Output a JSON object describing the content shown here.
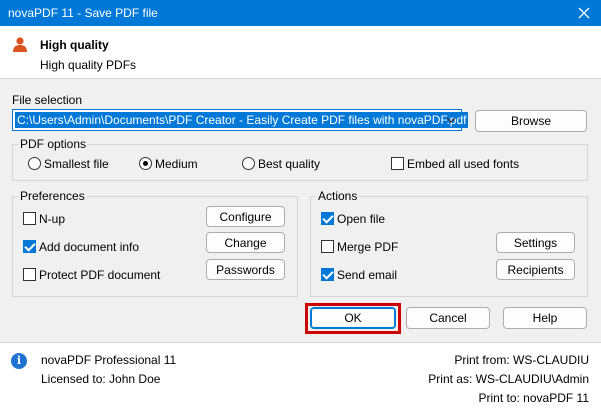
{
  "window": {
    "title": "novaPDF 11 - Save PDF file",
    "close_icon": "close-icon"
  },
  "profile": {
    "name": "High quality",
    "description": "High quality PDFs",
    "icon": "user-icon"
  },
  "file_selection": {
    "label": "File selection",
    "path": "C:\\Users\\Admin\\Documents\\PDF Creator - Easily Create PDF files with novaPDF.pdf",
    "browse_label": "Browse"
  },
  "pdf_options": {
    "label": "PDF options",
    "radios": [
      {
        "label": "Smallest file",
        "selected": false
      },
      {
        "label": "Medium",
        "selected": true
      },
      {
        "label": "Best quality",
        "selected": false
      }
    ],
    "embed_fonts": {
      "label": "Embed all used fonts",
      "checked": false
    }
  },
  "preferences": {
    "label": "Preferences",
    "options": [
      {
        "label": "N-up",
        "checked": false
      },
      {
        "label": "Add document info",
        "checked": true
      },
      {
        "label": "Protect PDF document",
        "checked": false
      }
    ],
    "buttons": [
      "Configure",
      "Change",
      "Passwords"
    ]
  },
  "actions": {
    "label": "Actions",
    "options": [
      {
        "label": "Open file",
        "checked": true
      },
      {
        "label": "Merge PDF",
        "checked": false
      },
      {
        "label": "Send email",
        "checked": true
      }
    ],
    "buttons": [
      "Settings",
      "Recipients"
    ]
  },
  "dialog_buttons": {
    "ok": "OK",
    "cancel": "Cancel",
    "help": "Help"
  },
  "highlight_color": "#cc0000",
  "footer": {
    "product": "novaPDF Professional 11",
    "licensed": "Licensed to: John Doe",
    "print_from": "Print from: WS-CLAUDIU",
    "print_as": "Print as: WS-CLAUDIU\\Admin",
    "print_to": "Print to: novaPDF 11"
  }
}
